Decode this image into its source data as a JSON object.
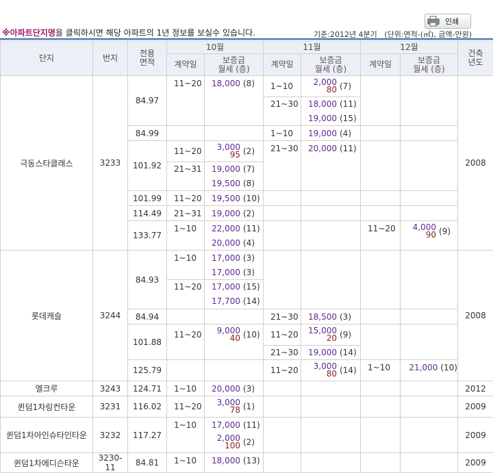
{
  "toolbar": {
    "print_label": "인쇄"
  },
  "notice": {
    "mark": "※",
    "link": "아파트단지명",
    "rest": "을 클릭하시면 해당 아파트의 1년 정보를 보실수 있습니다."
  },
  "basis": "기준:2012년 4분기   (단위:면적-(㎡), 금액-만원)",
  "header": {
    "complex": "단지",
    "lot": "번지",
    "area": "전용\n면적",
    "months": [
      "10월",
      "11월",
      "12월"
    ],
    "contract_day": "계약일",
    "deposit": "보증금\n월세 (층)",
    "built": "건축\n년도"
  },
  "rows": {
    "r1": {
      "name": "극동스타클래스",
      "lot": "3233",
      "year": "2008",
      "a1": "84.97",
      "a1_oct": [
        [
          "11~20",
          "18,000",
          "(8)"
        ]
      ],
      "a1_nov_1": [
        "1~10",
        "2,000",
        "80",
        "(7)"
      ],
      "a1_nov_2": [
        [
          "21~30",
          "18,000",
          "(11)"
        ],
        [
          "",
          "19,000",
          "(15)"
        ]
      ],
      "a2": "84.99",
      "a2_nov": [
        "1~10",
        "19,000",
        "(4)"
      ],
      "a3": "101.92",
      "a3_oct_1": [
        "11~20",
        "3,000",
        "95",
        "(2)"
      ],
      "a3_oct_2": [
        [
          "21~31",
          "19,000",
          "(7)"
        ],
        [
          "",
          "19,500",
          "(8)"
        ]
      ],
      "a3_nov": [
        "21~30",
        "20,000",
        "(11)"
      ],
      "a4": "101.99",
      "a4_oct": [
        "11~20",
        "19,500",
        "(10)"
      ],
      "a5": "114.49",
      "a5_oct": [
        "21~31",
        "19,000",
        "(2)"
      ],
      "a6": "133.77",
      "a6_oct": [
        [
          "1~10",
          "22,000",
          "(11)"
        ],
        [
          "",
          "20,000",
          "(4)"
        ]
      ],
      "a6_dec": [
        "11~20",
        "4,000",
        "90",
        "(9)"
      ]
    },
    "r2": {
      "name": "롯데캐슬",
      "lot": "3244",
      "year": "2008",
      "a1": "84.93",
      "a1_oct_1": [
        [
          "1~10",
          "17,000",
          "(3)"
        ],
        [
          "",
          "17,000",
          "(3)"
        ]
      ],
      "a1_oct_2": [
        [
          "11~20",
          "17,000",
          "(15)"
        ],
        [
          "",
          "17,700",
          "(14)"
        ]
      ],
      "a2": "84.94",
      "a2_nov": [
        "21~30",
        "18,500",
        "(3)"
      ],
      "a3": "101.88",
      "a3_oct": [
        "11~20",
        "9,000",
        "40",
        "(10)"
      ],
      "a3_nov_1": [
        "11~20",
        "15,000",
        "20",
        "(9)"
      ],
      "a3_nov_2": [
        "21~30",
        "19,000",
        "(14)"
      ],
      "a4": "125.79",
      "a4_nov": [
        "11~20",
        "3,000",
        "80",
        "(14)"
      ],
      "a4_dec": [
        "1~10",
        "21,000",
        "(10)"
      ]
    },
    "r3": {
      "name": "엘크루",
      "lot": "3243",
      "area": "124.71",
      "year": "2012",
      "oct": [
        "1~10",
        "20,000",
        "(3)"
      ]
    },
    "r4": {
      "name": "퀸덤1차링컨타운",
      "lot": "3231",
      "area": "116.02",
      "year": "2009",
      "oct": [
        "11~20",
        "3,000",
        "78",
        "(1)"
      ]
    },
    "r5": {
      "name": "퀸덤1차아인슈타인타운",
      "lot": "3232",
      "area": "117.27",
      "year": "2009",
      "oct_day": "1~10",
      "oct_1": [
        "17,000",
        "(11)"
      ],
      "oct_2": [
        "2,000",
        "100",
        "(2)"
      ]
    },
    "r6": {
      "name": "퀸덤1차에디슨타운",
      "lot": "3230-11",
      "area": "84.81",
      "year": "2009",
      "oct": [
        "1~10",
        "18,000",
        "(13)"
      ]
    }
  },
  "colors": {
    "accent_line": "#2f6ab6",
    "link": "#9c1c63",
    "price": "#5b2a91",
    "rent": "#8e1e1e",
    "header_bg": "#eceff6"
  }
}
